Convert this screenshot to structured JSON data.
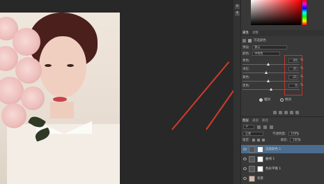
{
  "colors": {
    "accent_red": "#d33a2c",
    "selected_layer": "#4b6d8f",
    "panel_bg": "#383838",
    "canvas_bg": "#282828"
  },
  "toolbar_strip": {
    "tools": [
      "A",
      "¶"
    ]
  },
  "properties_panel": {
    "tabs": [
      "属性",
      "调整"
    ],
    "active_tab": "属性",
    "title": "可选颜色",
    "preset_label": "预设:",
    "preset_value": "默认",
    "colors_label": "颜色:",
    "colors_value": "中性色",
    "sliders": [
      {
        "label": "青色:",
        "value": "-20",
        "unit": "%",
        "level": 0.45
      },
      {
        "label": "洋红:",
        "value": "-31",
        "unit": "%",
        "level": 0.42
      },
      {
        "label": "黄色:",
        "value": "-21",
        "unit": "%",
        "level": 0.45
      },
      {
        "label": "黑色:",
        "value": "0",
        "unit": "%",
        "level": 0.5
      }
    ],
    "method_relative": "相对",
    "method_absolute": "绝对"
  },
  "layers_panel": {
    "tabs": [
      "图层",
      "通道",
      "路径"
    ],
    "active_tab": "图层",
    "blend_mode": "正常",
    "opacity_label": "不透明度:",
    "opacity_value": "100%",
    "lock_label": "锁定:",
    "fill_label": "填充:",
    "fill_value": "100%",
    "layers": [
      {
        "name": "选取颜色 1",
        "type": "adjustment",
        "selected": true
      },
      {
        "name": "曲线 1",
        "type": "adjustment",
        "selected": false
      },
      {
        "name": "色彩平衡 1",
        "type": "adjustment",
        "selected": false
      },
      {
        "name": "背景",
        "type": "image",
        "selected": false
      }
    ]
  }
}
